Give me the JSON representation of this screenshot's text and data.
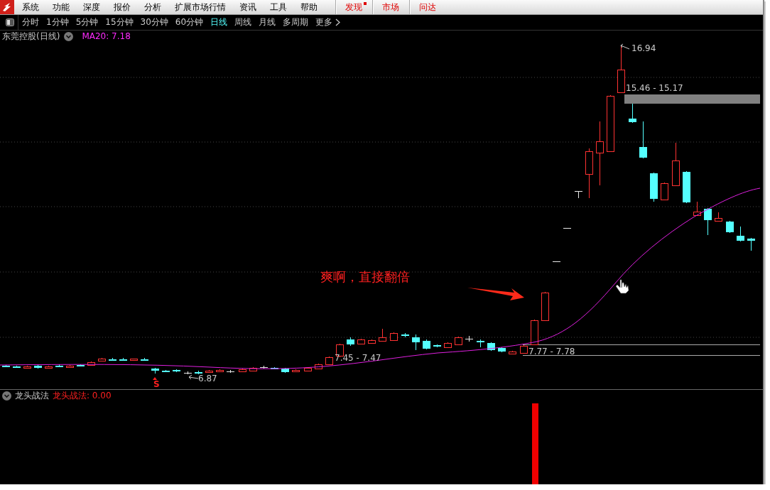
{
  "menu_bar": {
    "items": [
      {
        "label": "系统"
      },
      {
        "label": "功能"
      },
      {
        "label": "深度"
      },
      {
        "label": "报价"
      },
      {
        "label": "分析"
      },
      {
        "label": "扩展市场行情"
      },
      {
        "label": "资讯"
      },
      {
        "label": "工具"
      },
      {
        "label": "帮助"
      }
    ],
    "special_items": [
      {
        "label": "发现",
        "badge": true
      },
      {
        "label": "市场",
        "badge": false
      },
      {
        "label": "问达",
        "badge": false
      }
    ]
  },
  "period_tabs": [
    {
      "label": "分时",
      "selected": false,
      "kind": "period"
    },
    {
      "label": "1分钟",
      "selected": false,
      "kind": "period"
    },
    {
      "label": "5分钟",
      "selected": false,
      "kind": "period"
    },
    {
      "label": "15分钟",
      "selected": false,
      "kind": "period"
    },
    {
      "label": "30分钟",
      "selected": false,
      "kind": "period"
    },
    {
      "label": "60分钟",
      "selected": false,
      "kind": "period"
    },
    {
      "label": "日线",
      "selected": true,
      "kind": "period"
    },
    {
      "label": "周线",
      "selected": false,
      "kind": "period"
    },
    {
      "label": "月线",
      "selected": false,
      "kind": "period"
    },
    {
      "label": "多周期",
      "selected": false,
      "kind": "period"
    },
    {
      "label": "更多",
      "selected": false,
      "kind": "more"
    }
  ],
  "chart": {
    "title": "东莞控股(日线)",
    "ma_label": "MA20: 7.18",
    "annotation": "爽啊，直接翻倍",
    "signal_mark": "S",
    "price_labels": [
      {
        "text": "16.94"
      },
      {
        "text": "15.46 - 15.17"
      },
      {
        "text": "7.77 - 7.78"
      },
      {
        "text": "7.45 - 7.47"
      },
      {
        "text": "6.87"
      }
    ]
  },
  "indicator": {
    "name": "龙头战法",
    "reading": "龙头战法: 0.00"
  }
}
